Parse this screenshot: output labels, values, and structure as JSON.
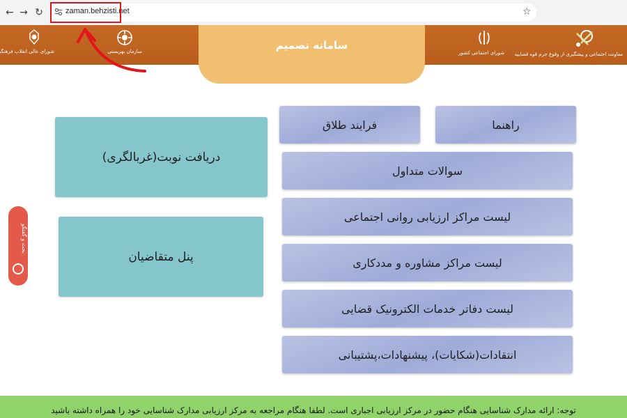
{
  "browser": {
    "url": "zaman.behzisti.net"
  },
  "header": {
    "title": "سامانه تصمیم",
    "logos": {
      "left_council": "شورای عالی انقلاب فرهنگی",
      "behzisti": "سازمان بهزیستی",
      "social_council": "شورای اجتماعی کشور",
      "deputy": "معاونت اجتماعی و پیشگیری از وقوع جرم قوه قضاییه"
    }
  },
  "menu": {
    "guide": "راهنما",
    "divorce_process": "فرایند طلاق",
    "faq": "سوالات متداول",
    "assessment_centers": "لیست مراکز ارزیابی روانی اجتماعی",
    "counseling_centers": "لیست مراکز مشاوره و مددکاری",
    "judicial_offices": "لیست دفاتر خدمات الکترونیک قضایی",
    "feedback": "انتقادات(شکایات)، پیشنهادات،پشتیبانی",
    "get_appointment": "دریافت نوبت(غربالگری)",
    "applicant_panel": "پنل متقاضیان"
  },
  "side_tab": {
    "label": "بحث و گفتگو"
  },
  "notice": {
    "text": "توجه: ارائه مدارک شناسایی هنگام حضور در مرکز ارزیابی اجباری است. لطفا هنگام مراجعه به مرکز ارزیابی مدارک شناسایی خود را همراه داشته باشید"
  },
  "colors": {
    "header": "#c0651f",
    "title_tab": "#f2be6f",
    "tile_blue": "#a9b4dd",
    "tile_teal": "#85c6cc",
    "notice": "#8fd36a",
    "side_tab": "#e35a4b",
    "highlight": "#e3151a"
  }
}
